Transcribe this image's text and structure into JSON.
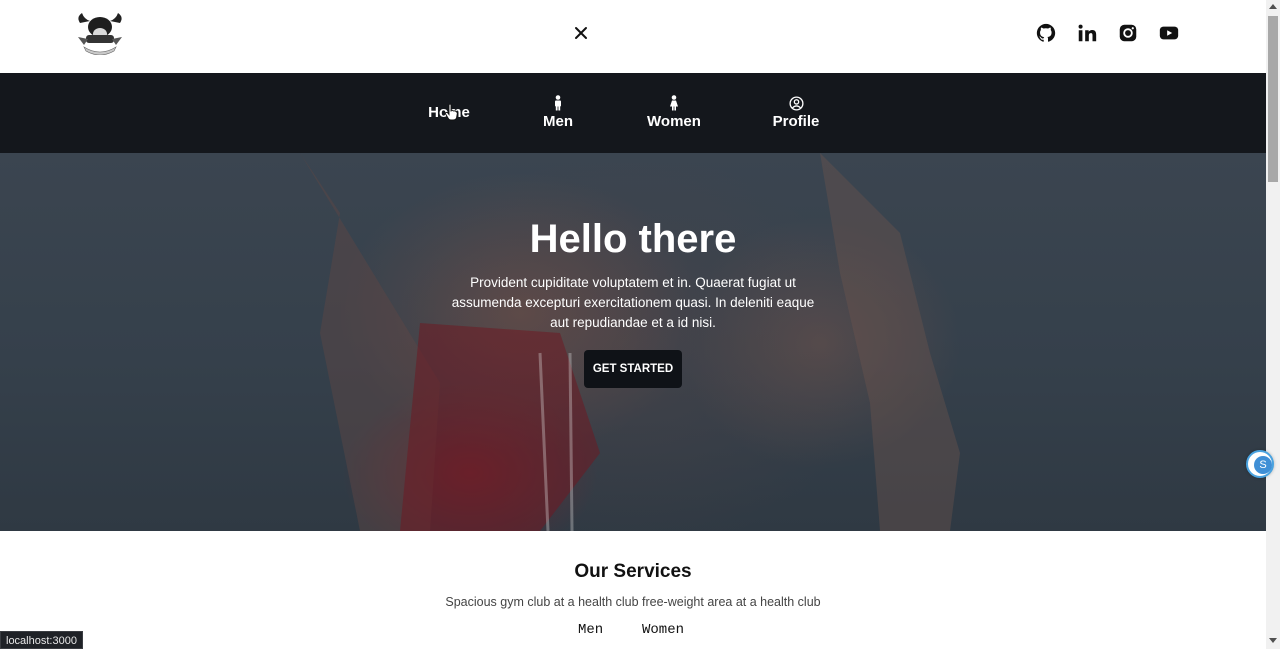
{
  "topbar": {
    "logo_icon": "bull-gym-logo",
    "close_icon": "close-icon",
    "social": [
      {
        "name": "github-icon"
      },
      {
        "name": "linkedin-icon"
      },
      {
        "name": "instagram-icon"
      },
      {
        "name": "youtube-icon"
      }
    ]
  },
  "nav": {
    "items": [
      {
        "label": "Home",
        "icon": ""
      },
      {
        "label": "Men",
        "icon": "male-icon"
      },
      {
        "label": "Women",
        "icon": "female-icon"
      },
      {
        "label": "Profile",
        "icon": "user-circle-icon"
      }
    ]
  },
  "hero": {
    "title": "Hello there",
    "text": "Provident cupiditate voluptatem et in. Quaerat fugiat ut assumenda excepturi exercitationem quasi. In deleniti eaque aut repudiandae et a id nisi.",
    "button_label": "GET STARTED"
  },
  "services": {
    "title": "Our Services",
    "subtitle": "Spacious gym club at a health club free-weight area at a health club",
    "tabs": [
      "Men",
      "Women"
    ]
  },
  "widget": {
    "label": "S"
  },
  "status_bar": {
    "url": "localhost:3000"
  },
  "colors": {
    "nav_bg": "#14171c",
    "button_bg": "#0f1217",
    "hero_bg": "#37414c"
  }
}
